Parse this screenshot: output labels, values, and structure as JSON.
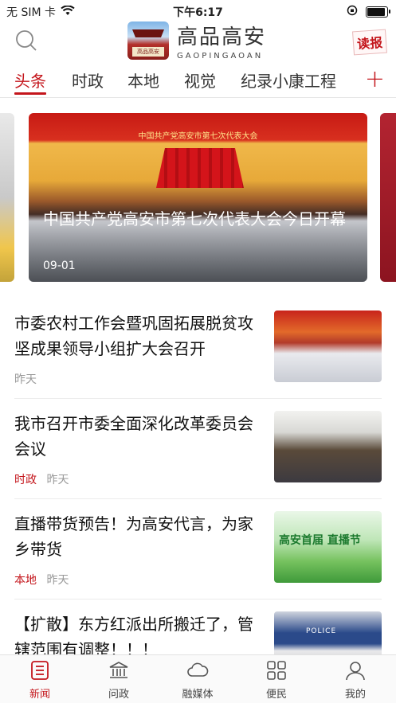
{
  "status_bar": {
    "carrier": "无 SIM 卡",
    "time": "下午6:17"
  },
  "header": {
    "logo_plaque": "高品高安",
    "logo_title": "高品高安",
    "logo_subtitle": "GAOPINGAOAN",
    "read_paper_label": "读报"
  },
  "tabs": [
    {
      "label": "头条",
      "active": true
    },
    {
      "label": "时政",
      "active": false
    },
    {
      "label": "本地",
      "active": false
    },
    {
      "label": "视觉",
      "active": false
    },
    {
      "label": "纪录小康工程",
      "active": false
    }
  ],
  "carousel": {
    "banner_text": "中国共产党高安市第七次代表大会",
    "title": "中国共产党高安市第七次代表大会今日开幕",
    "date": "09-01"
  },
  "news": [
    {
      "title": "市委农村工作会暨巩固拓展脱贫攻坚成果领导小组扩大会召开",
      "category": "",
      "time": "昨天"
    },
    {
      "title": "我市召开市委全面深化改革委员会会议",
      "category": "时政",
      "time": "昨天"
    },
    {
      "title": "直播带货预告！为高安代言，为家乡带货",
      "category": "本地",
      "time": "昨天",
      "thumb_text": "高安首届 直播节"
    },
    {
      "title": "【扩散】东方红派出所搬迁了，管辖范围有调整！！！",
      "category": "",
      "time": "",
      "thumb_text": "POLICE"
    }
  ],
  "tabbar": [
    {
      "label": "新闻",
      "icon": "news-icon",
      "active": true
    },
    {
      "label": "问政",
      "icon": "government-building-icon",
      "active": false
    },
    {
      "label": "融媒体",
      "icon": "cloud-icon",
      "active": false
    },
    {
      "label": "便民",
      "icon": "grid-icon",
      "active": false
    },
    {
      "label": "我的",
      "icon": "user-icon",
      "active": false
    }
  ],
  "colors": {
    "accent": "#c4161c",
    "text": "#111111",
    "meta": "#999999"
  }
}
